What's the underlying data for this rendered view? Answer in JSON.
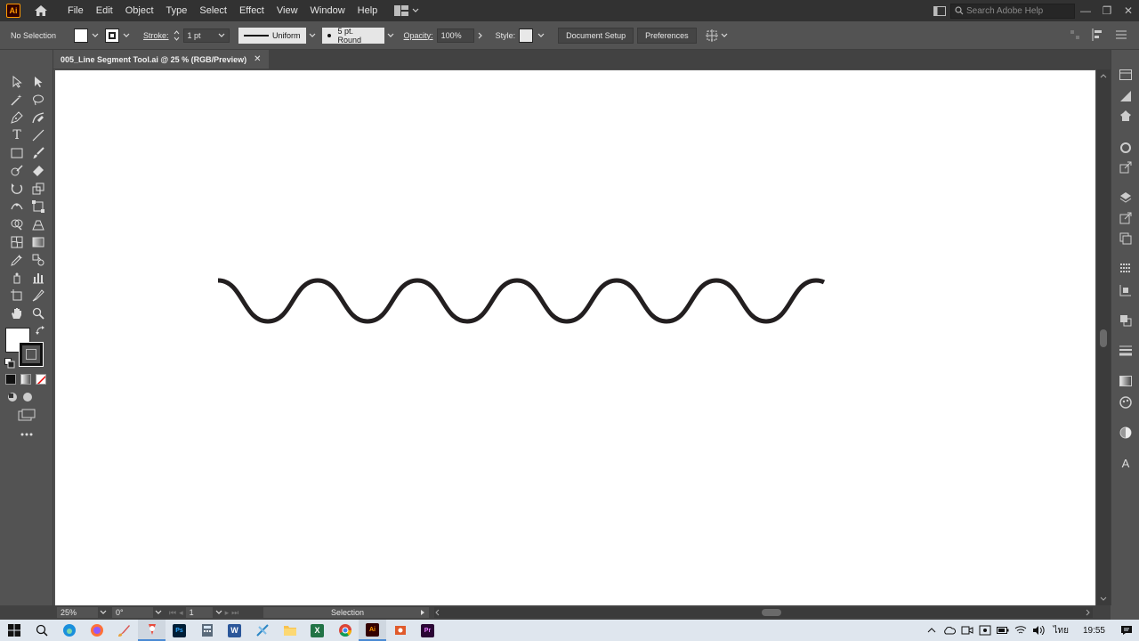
{
  "app": {
    "logo": "Ai",
    "menus": [
      "File",
      "Edit",
      "Object",
      "Type",
      "Select",
      "Effect",
      "View",
      "Window",
      "Help"
    ],
    "search_placeholder": "Search Adobe Help"
  },
  "control_bar": {
    "selection_label": "No Selection",
    "stroke_label": "Stroke:",
    "stroke_weight": "1 pt",
    "stroke_profile": "Uniform",
    "brush": "5 pt. Round",
    "opacity_label": "Opacity:",
    "opacity_value": "100%",
    "style_label": "Style:",
    "document_setup_label": "Document Setup",
    "preferences_label": "Preferences"
  },
  "document": {
    "tab_title": "005_Line Segment Tool.ai @ 25 % (RGB/Preview)",
    "close_glyph": "✕"
  },
  "status_bar": {
    "zoom": "25%",
    "rotation": "0°",
    "artboard_number": "1",
    "current_tool": "Selection"
  },
  "taskbar": {
    "language": "ไทย",
    "time": "19:55"
  },
  "colors": {
    "ui_dark": "#323232",
    "ui_mid": "#535353",
    "artboard": "#ffffff",
    "wave_stroke": "#231f20",
    "ai_orange": "#ff9a00"
  }
}
